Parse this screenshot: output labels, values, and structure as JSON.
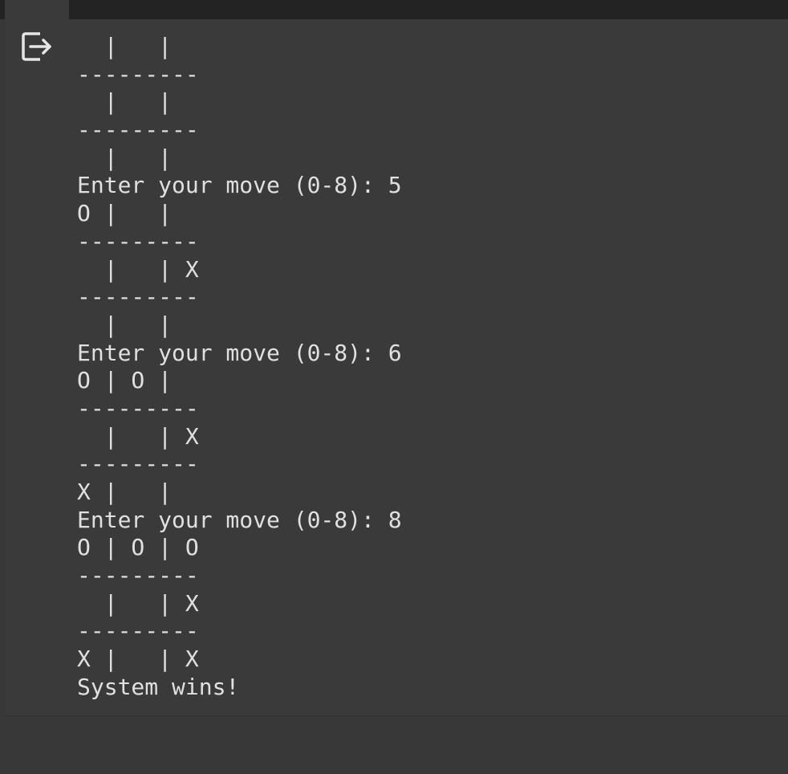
{
  "console": {
    "lines": [
      "  |   |",
      "---------",
      "  |   |",
      "---------",
      "  |   |",
      "Enter your move (0-8): 5",
      "O |   |",
      "---------",
      "  |   | X",
      "---------",
      "  |   |",
      "Enter your move (0-8): 6",
      "O | O |",
      "---------",
      "  |   | X",
      "---------",
      "X |   |",
      "Enter your move (0-8): 8",
      "O | O | O",
      "---------",
      "  |   | X",
      "---------",
      "X |   | X",
      "System wins!"
    ]
  },
  "icons": {
    "output_icon": "output-exit-icon"
  },
  "colors": {
    "background": "#383838",
    "panel": "#3a3a3a",
    "top_bar": "#232323",
    "text": "#e0e0e0"
  }
}
